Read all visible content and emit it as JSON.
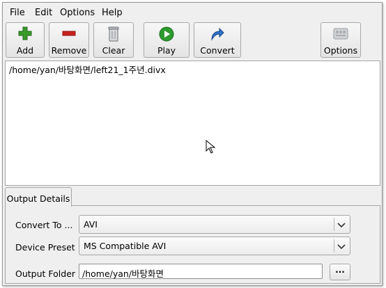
{
  "menu": {
    "file": "File",
    "edit": "Edit",
    "options": "Options",
    "help": "Help"
  },
  "toolbar": {
    "add": "Add",
    "remove": "Remove",
    "clear": "Clear",
    "play": "Play",
    "convert": "Convert",
    "options": "Options"
  },
  "file_list": [
    "/home/yan/바탕화면/left21_1주년.divx"
  ],
  "tabs": {
    "output_details": "Output Details"
  },
  "output": {
    "convert_to_label": "Convert To ...",
    "convert_to_value": "AVI",
    "device_preset_label": "Device Preset",
    "device_preset_value": "MS Compatible AVI",
    "output_folder_label": "Output Folder",
    "output_folder_value": "/home/yan/바탕화면",
    "browse_label": "..."
  },
  "icons": {
    "add": "plus-icon",
    "remove": "minus-icon",
    "clear": "trash-icon",
    "play": "play-icon",
    "convert": "convert-arrow-icon",
    "options": "options-icon"
  },
  "colors": {
    "add": "#3a9a2a",
    "remove": "#c8231e",
    "play": "#2f9b2f",
    "convert": "#2d71c9"
  }
}
